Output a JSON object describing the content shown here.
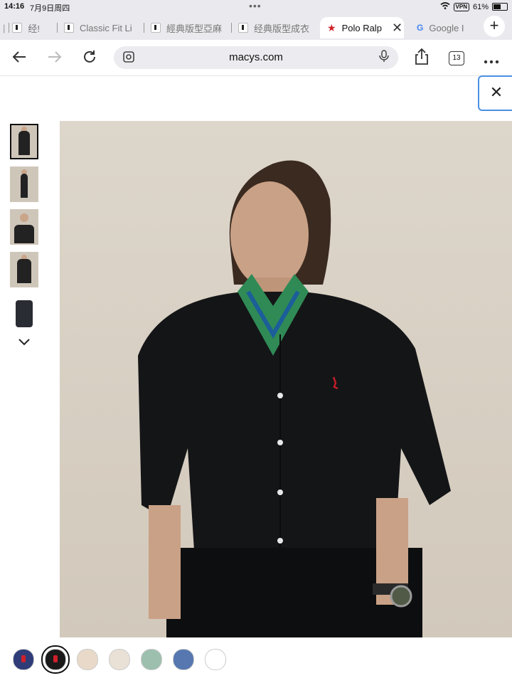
{
  "status": {
    "time": "14:16",
    "date": "7月9日周四",
    "dots": "•••",
    "vpn": "VPN",
    "battery": "61%",
    "battery_level": 0.61
  },
  "tabs": [
    {
      "label": "经!"
    },
    {
      "label": "Classic Fit Li"
    },
    {
      "label": "經典版型亞麻"
    },
    {
      "label": "经典版型成衣"
    },
    {
      "label": "Polo Ralp",
      "active": true
    },
    {
      "label": "Google I"
    }
  ],
  "toolbar": {
    "url": "macys.com",
    "tab_count": "13",
    "new_tab": "+"
  },
  "icons": {
    "back": "back-arrow-icon",
    "forward": "forward-arrow-icon",
    "reload": "reload-icon",
    "share": "share-icon",
    "more": "more-icon",
    "close": "close-icon",
    "chevron": "chevron-down-icon"
  },
  "gallery": {
    "thumbnails": [
      "look-front",
      "look-full",
      "look-close",
      "look-side",
      "shirt-flat"
    ],
    "selected_index": 0
  },
  "swatches": [
    {
      "color": "#2f3c78",
      "pony": true
    },
    {
      "color": "#1a1a1a",
      "pony": true,
      "selected": true
    },
    {
      "color": "#e8d9c8"
    },
    {
      "color": "#e9e0d6"
    },
    {
      "color": "#9dbfae"
    },
    {
      "color": "#5677b0"
    },
    {
      "color": "#ffffff"
    }
  ]
}
